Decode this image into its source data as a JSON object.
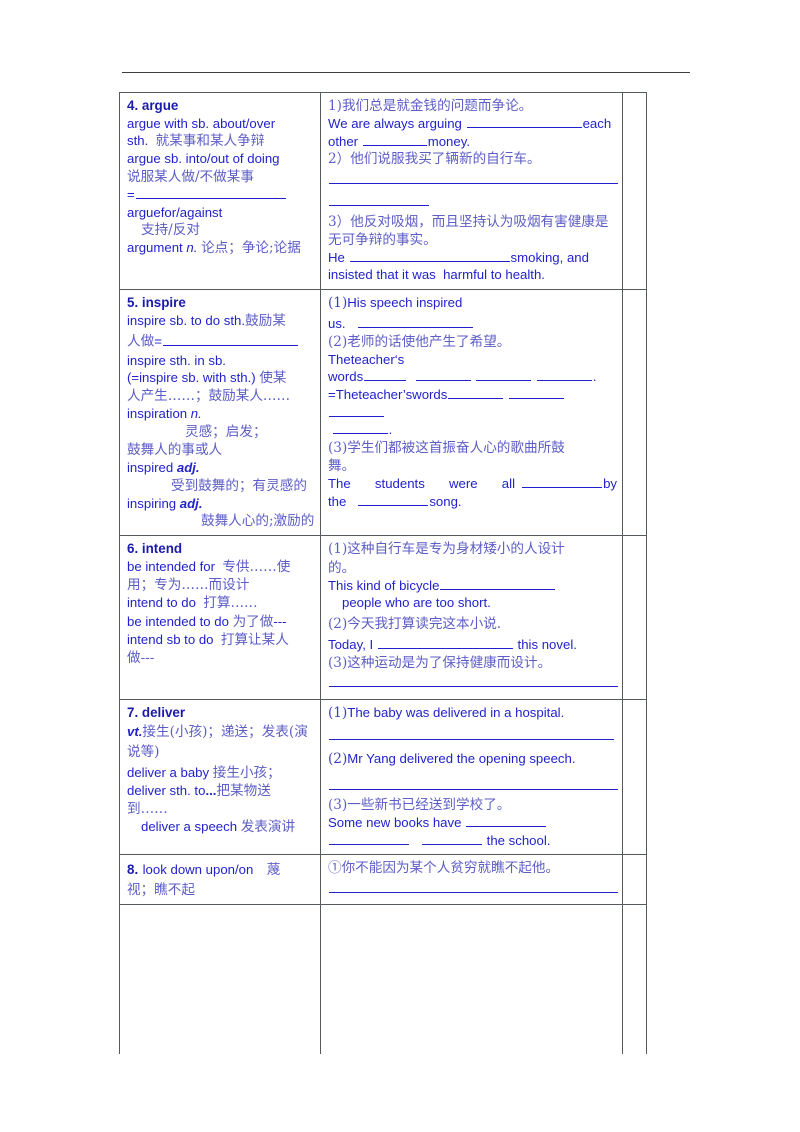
{
  "document": {
    "type": "vocabulary-worksheet",
    "colors": {
      "heading": "#1b1bab",
      "english": "#2222cc",
      "chinese": "#5d5dc6",
      "border": "#555a5e",
      "rule": "#3d3d3d"
    }
  },
  "entries": [
    {
      "id": "argue",
      "heading": "4. argue",
      "term_lines": [
        "argue with sb. about/over",
        "sth.  就某事和某人争辩",
        "argue sb. into/out of doing",
        "说服某人做/不做某事",
        "=",
        "arguefor/against",
        "支持/反对",
        "argument n. 论点；争论;论据"
      ],
      "example_lines": [
        "1)我们总是就金钱的问题而争论。",
        "We are always arguing ____________each other _______money.",
        "2）他们说服我买了辆新的自行车。",
        "3）他反对吸烟，而且坚持认为吸烟有害健康是无可争辩的事实。",
        "He __________________smoking, and insisted that it was  harmful to health."
      ]
    },
    {
      "id": "inspire",
      "heading": "5. inspire",
      "term_lines": [
        "inspire sb. to do sth.鼓励某人做=",
        "inspire sth. in sb.",
        "(=inspire sb. with sth.) 使某人产生……；鼓励某人……",
        "inspiration n.",
        "灵感；启发；鼓舞人的事或人",
        "inspired adj.",
        "受到鼓舞的；有灵感的",
        "inspiring adj.",
        "鼓舞人心的;激励的"
      ],
      "example_lines": [
        "(1)His speech inspired us.  ____________",
        "(2)老师的话使他产生了希望。",
        "Theteacher's words_____  ______  ______  ______.",
        "=Theteacher'swords_____  ______  ______  _____.",
        "(3)学生们都被这首振奋人心的歌曲所鼓舞。",
        "The students were all __________by the _________song."
      ]
    },
    {
      "id": "intend",
      "heading": "6. intend",
      "term_lines": [
        "be intended for  专供……使用；专为……而设计",
        "intend to do  打算……",
        "be intended to do 为了做---",
        "intend sb to do  打算让某人做---"
      ],
      "example_lines": [
        "(1)这种自行车是专为身材矮小的人设计的。",
        "This kind of bicycle______________  people who are too short.",
        "(2)今天我打算读完这本小说.",
        "Today, I _________________ this novel.",
        "(3)这种运动是为了保持健康而设计。"
      ]
    },
    {
      "id": "deliver",
      "heading": "7. deliver",
      "term_lines": [
        "vt.接生(小孩)；递送；发表(演说等)",
        "deliver a baby 接生小孩；",
        "deliver sth. to...把某物送到……",
        "deliver a speech 发表演讲"
      ],
      "example_lines": [
        "(1)The baby was delivered in a hospital.",
        "(2)Mr Yang delivered the opening speech.",
        "(3)一些新书已经送到学校了。",
        "Some new books have _________ __________  _______ the school."
      ]
    },
    {
      "id": "look-down-upon",
      "heading": "8. look down upon/on",
      "term_lines": [
        "8. look down upon/on   蔑",
        "视；瞧不起"
      ],
      "example_lines": [
        "①你不能因为某个人贫穷就瞧不起他。"
      ]
    }
  ],
  "labels": {
    "blank_marker": "____________",
    "equals": "="
  }
}
